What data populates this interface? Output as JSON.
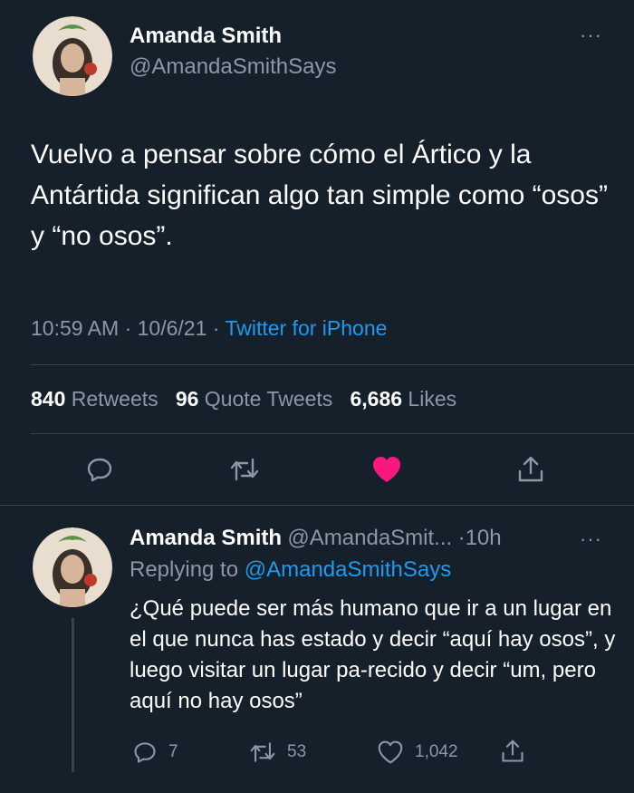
{
  "tweet": {
    "author_name": "Amanda Smith",
    "author_handle": "@AmandaSmithSays",
    "more_label": "···",
    "text": "Vuelvo a pensar sobre cómo el Ártico y la Antártida significan algo tan simple como “osos” y “no osos”.",
    "time": "10:59 AM",
    "date": "10/6/21",
    "sep": "·",
    "source": "Twitter for iPhone",
    "retweets_count": "840",
    "retweets_label": "Retweets",
    "quotes_count": "96",
    "quotes_label": "Quote Tweets",
    "likes_count": "6,686",
    "likes_label": "Likes",
    "liked": true,
    "like_color": "#f91880"
  },
  "reply": {
    "author_name": "Amanda Smith",
    "author_handle": "@AmandaSmit...",
    "age": "·10h",
    "more_label": "···",
    "replying_prefix": "Replying to",
    "replying_to": "@AmandaSmithSays",
    "text": "¿Qué puede ser más humano que ir a un lugar en el que nunca has estado y decir “aquí hay osos”, y luego visitar un lugar pa-recido y decir “um, pero aquí no hay osos”",
    "reply_count": "7",
    "retweet_count": "53",
    "like_count": "1,042"
  },
  "colors": {
    "background": "#15202b",
    "link": "#1d9bf0",
    "muted": "#8b98a5"
  }
}
